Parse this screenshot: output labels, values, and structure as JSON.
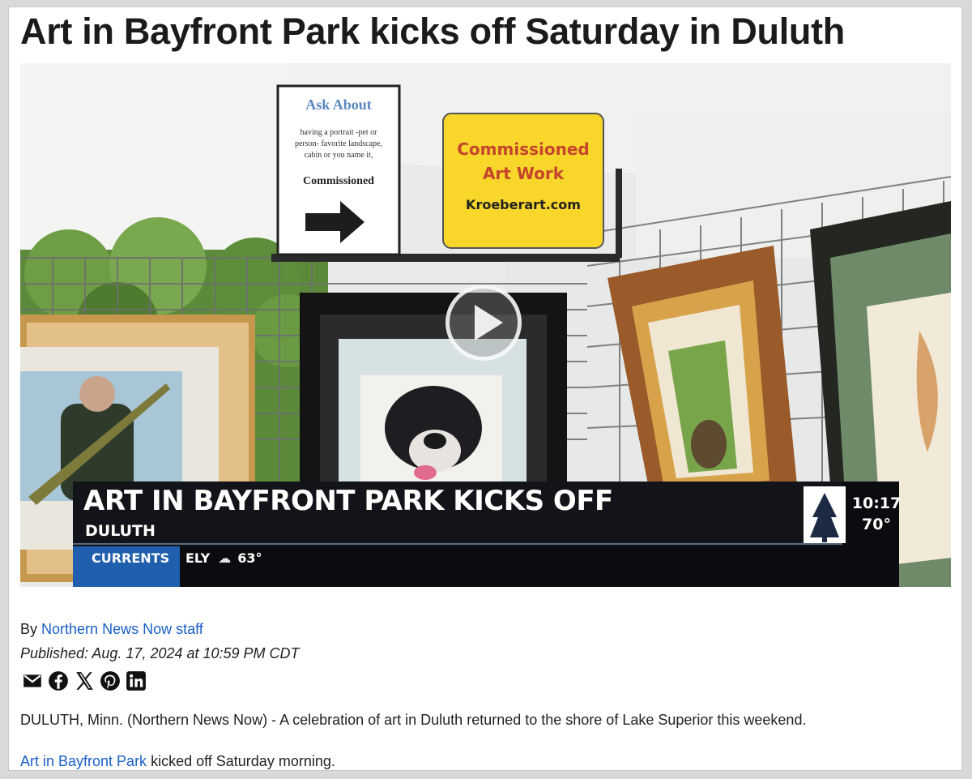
{
  "article": {
    "headline": "Art in Bayfront Park kicks off Saturday in Duluth",
    "byline_prefix": "By",
    "author": "Northern News Now staff",
    "published": "Published: Aug. 17, 2024 at 10:59 PM CDT",
    "share_icons": [
      "email-icon",
      "facebook-icon",
      "x-icon",
      "pinterest-icon",
      "linkedin-icon"
    ],
    "paragraph1": "DULUTH, Minn. (Northern News Now) - A celebration of art in Duluth returned to the shore of Lake Superior this weekend.",
    "paragraph2_link": "Art in Bayfront Park",
    "paragraph2_rest": " kicked off Saturday morning."
  },
  "video": {
    "sign_ask": {
      "title": "Ask About",
      "line1": "having a portrait -pet or",
      "line2": "person- favorite landscape,",
      "line3": "cabin or you name it,",
      "line4": "Commissioned"
    },
    "sign_commission": {
      "line1": "Commissioned",
      "line2": "Art Work",
      "line3": "Kroeberart.com"
    },
    "lower_third": {
      "title": "ART IN BAYFRONT PARK KICKS OFF",
      "subtitle": "DULUTH",
      "section": "CURRENTS",
      "city": "ELY",
      "temp": "63°",
      "time": "10:17",
      "current_temp": "70°"
    }
  },
  "colors": {
    "link": "#1a5fc8",
    "currents_bar": "#1f5fae",
    "lower_third_bg": "#111318"
  }
}
